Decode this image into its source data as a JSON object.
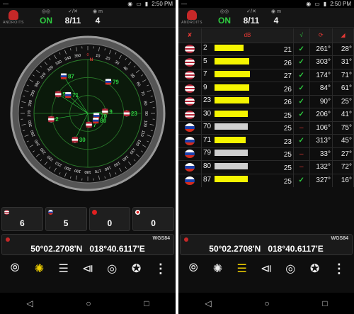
{
  "status": {
    "carrier": "—",
    "time": "2:50 PM",
    "icons": [
      "location-icon",
      "vibrate-icon",
      "battery-icon"
    ]
  },
  "header": {
    "app_logo_text": "ANDROITS",
    "gps_label": "ON",
    "sats_label": "8/11",
    "accuracy_label": "4",
    "accuracy_icon_text": "m"
  },
  "compass": {
    "degree_labels": [
      "0",
      "10",
      "20",
      "30",
      "40",
      "50",
      "60",
      "70",
      "80",
      "90",
      "100",
      "110",
      "120",
      "130",
      "140",
      "150",
      "160",
      "170",
      "180",
      "190",
      "200",
      "210",
      "220",
      "230",
      "240",
      "250",
      "260",
      "270",
      "280",
      "290",
      "300",
      "310",
      "320",
      "330",
      "340",
      "350"
    ],
    "north_label": "N",
    "satellites": [
      {
        "id": "2",
        "flag": "us",
        "az": 261,
        "el": 28,
        "used": true
      },
      {
        "id": "5",
        "flag": "us",
        "az": 303,
        "el": 31,
        "used": true
      },
      {
        "id": "7",
        "flag": "us",
        "az": 174,
        "el": 71,
        "used": true
      },
      {
        "id": "9",
        "flag": "us",
        "az": 84,
        "el": 61,
        "used": true
      },
      {
        "id": "23",
        "flag": "us",
        "az": 90,
        "el": 25,
        "used": true
      },
      {
        "id": "30",
        "flag": "us",
        "az": 206,
        "el": 41,
        "used": true
      },
      {
        "id": "70",
        "flag": "ru",
        "az": 106,
        "el": 75,
        "used": false
      },
      {
        "id": "71",
        "flag": "ru",
        "az": 313,
        "el": 45,
        "used": true
      },
      {
        "id": "79",
        "flag": "ru",
        "az": 33,
        "el": 27,
        "used": false
      },
      {
        "id": "80",
        "flag": "ru",
        "az": 132,
        "el": 72,
        "used": false
      },
      {
        "id": "87",
        "flag": "ru",
        "az": 327,
        "el": 16,
        "used": true
      }
    ]
  },
  "counts": {
    "gps": "6",
    "glonass": "5",
    "beidou": "0",
    "qzss": "0"
  },
  "location": {
    "datum": "WGS84",
    "lat": "50°02.2708'N",
    "lon": "018°40.6117'E"
  },
  "table": {
    "headers": {
      "sat": "sat-icon",
      "db": "dB",
      "used": "√",
      "az": "az-icon",
      "el": "el-icon"
    },
    "rows": [
      {
        "id": "2",
        "flag": "us",
        "db": "21",
        "bar": 0.55,
        "color": "#f5f500",
        "used": true,
        "az": "261°",
        "el": "28°"
      },
      {
        "id": "5",
        "flag": "us",
        "db": "26",
        "bar": 0.66,
        "color": "#f5f500",
        "used": true,
        "az": "303°",
        "el": "31°"
      },
      {
        "id": "7",
        "flag": "us",
        "db": "27",
        "bar": 0.68,
        "color": "#f5f500",
        "used": true,
        "az": "174°",
        "el": "71°"
      },
      {
        "id": "9",
        "flag": "us",
        "db": "26",
        "bar": 0.66,
        "color": "#f5f500",
        "used": true,
        "az": "84°",
        "el": "61°"
      },
      {
        "id": "23",
        "flag": "us",
        "db": "26",
        "bar": 0.66,
        "color": "#f5f500",
        "used": true,
        "az": "90°",
        "el": "25°"
      },
      {
        "id": "30",
        "flag": "us",
        "db": "25",
        "bar": 0.64,
        "color": "#f5f500",
        "used": true,
        "az": "206°",
        "el": "41°"
      },
      {
        "id": "70",
        "flag": "ru",
        "db": "25",
        "bar": 0.64,
        "color": "#cfcfcf",
        "used": false,
        "az": "106°",
        "el": "75°"
      },
      {
        "id": "71",
        "flag": "ru",
        "db": "23",
        "bar": 0.6,
        "color": "#f5f500",
        "used": true,
        "az": "313°",
        "el": "45°"
      },
      {
        "id": "79",
        "flag": "ru",
        "db": "25",
        "bar": 0.64,
        "color": "#cfcfcf",
        "used": false,
        "az": "33°",
        "el": "27°"
      },
      {
        "id": "80",
        "flag": "ru",
        "db": "25",
        "bar": 0.64,
        "color": "#cfcfcf",
        "used": false,
        "az": "132°",
        "el": "72°"
      },
      {
        "id": "87",
        "flag": "ru",
        "db": "25",
        "bar": 0.64,
        "color": "#f5f500",
        "used": true,
        "az": "327°",
        "el": "16°"
      }
    ]
  },
  "colors": {
    "used": "#2ecc40",
    "unused": "#e53935",
    "bar_used": "#f5f500",
    "bar_unused": "#cfcfcf",
    "accent": "#f0d000"
  }
}
